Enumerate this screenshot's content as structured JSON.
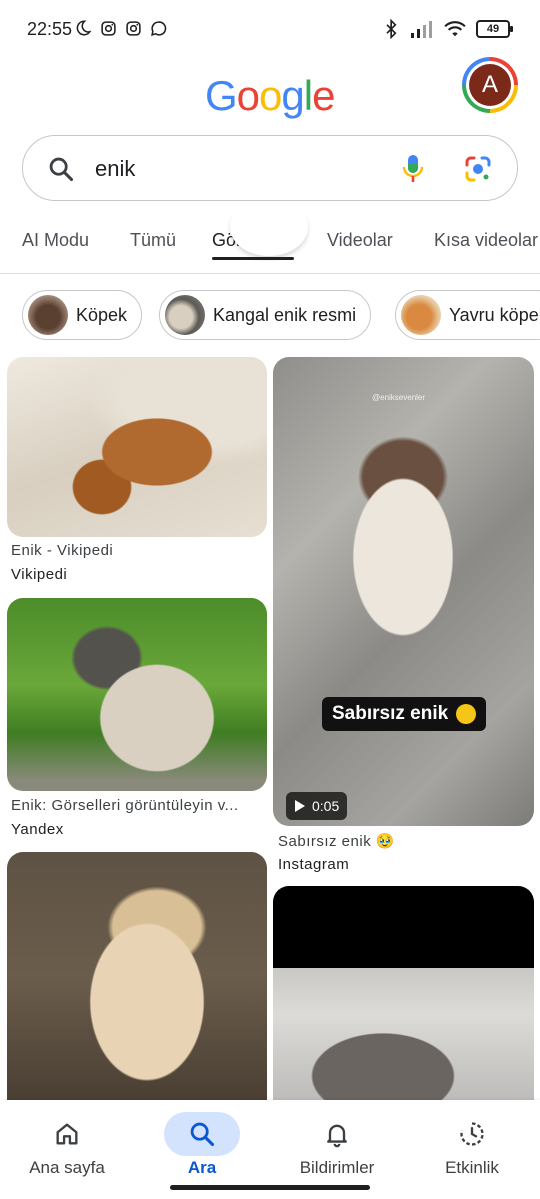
{
  "status_bar": {
    "time": "22:55",
    "battery": "49"
  },
  "header": {
    "logo_letters": [
      "G",
      "o",
      "o",
      "g",
      "l",
      "e"
    ],
    "logo_colors": [
      "#4285f4",
      "#ea4335",
      "#fbbc05",
      "#4285f4",
      "#34a853",
      "#ea4335"
    ],
    "avatar_letter": "A"
  },
  "search": {
    "query": "enik"
  },
  "tabs": [
    {
      "label": "AI Modu"
    },
    {
      "label": "Tümü"
    },
    {
      "label": "Görseller",
      "active": true
    },
    {
      "label": "Videolar"
    },
    {
      "label": "Kısa videolar"
    }
  ],
  "chips": [
    {
      "label": "Köpek"
    },
    {
      "label": "Kangal enik resmi"
    },
    {
      "label": "Yavru köpek"
    }
  ],
  "results": [
    {
      "title": "Enik - Vikipedi",
      "source": "Vikipedi"
    },
    {
      "title": "Enik: Görselleri görüntüleyin v...",
      "source": "Yandex"
    },
    {
      "title": "",
      "source": ""
    },
    {
      "title": "Sabırsız enik 🥹",
      "source": "Instagram",
      "overlay": "Sabırsız enik",
      "duration": "0:05",
      "watermark": "@eniksevenler"
    },
    {
      "title": "",
      "source": ""
    }
  ],
  "bottom_nav": [
    {
      "label": "Ana sayfa",
      "icon": "home-icon"
    },
    {
      "label": "Ara",
      "icon": "search-icon",
      "active": true
    },
    {
      "label": "Bildirimler",
      "icon": "bell-icon"
    },
    {
      "label": "Etkinlik",
      "icon": "history-icon"
    }
  ],
  "colors": {
    "accent": "#0b57d0",
    "active_pill": "#d3e3fd"
  }
}
